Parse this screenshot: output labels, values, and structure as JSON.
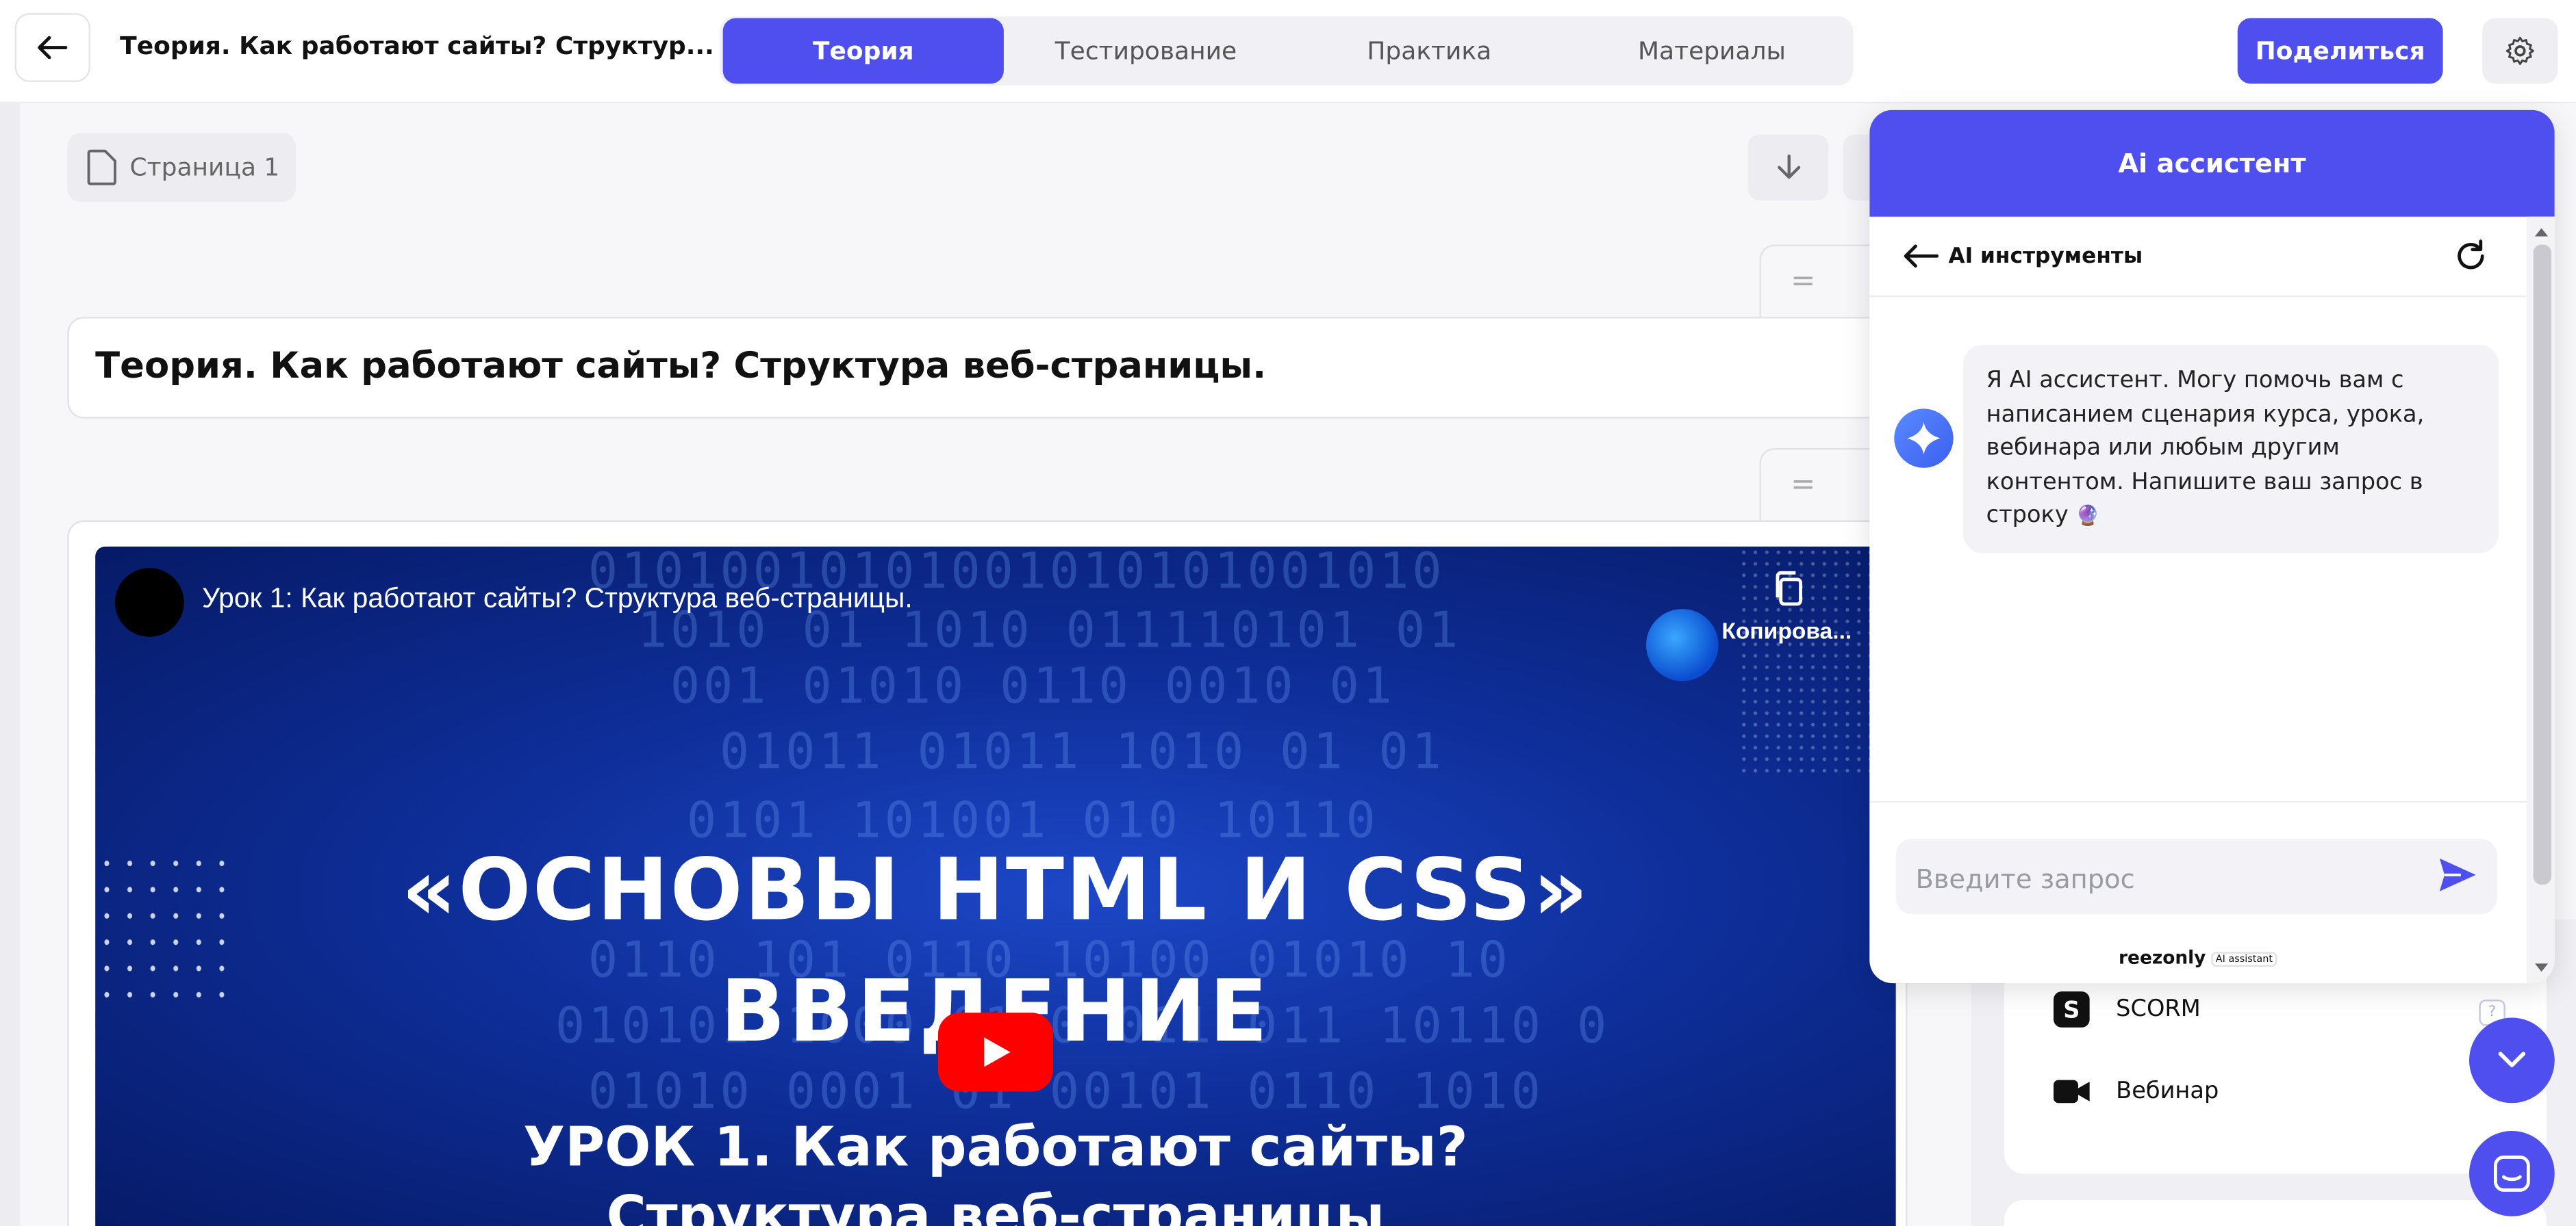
{
  "header": {
    "title": "Теория. Как работают сайты? Структур...",
    "tabs": [
      "Теория",
      "Тестирование",
      "Практика",
      "Материалы"
    ],
    "active_tab": "Теория",
    "share_label": "Поделиться"
  },
  "editor": {
    "page_label": "Страница 1",
    "block_title": "Теория. Как работают сайты? Структура веб-страницы.",
    "video": {
      "title": "Урок 1: Как работают сайты? Структура веб-страницы.",
      "copy_label": "Копирова...",
      "heading_1": "«ОСНОВЫ HTML И CSS»",
      "heading_2": "ВВЕДЕНИЕ",
      "heading_3": "УРОК 1. Как работают сайты?",
      "heading_4": "Структура веб-страницы"
    }
  },
  "side_panel": {
    "items": [
      {
        "label": "SCORM",
        "icon": "scorm-icon"
      },
      {
        "label": "Вебинар",
        "icon": "video-camera-icon"
      }
    ]
  },
  "chat": {
    "title": "Ai ассистент",
    "back_label": "AI инструменты",
    "message": "Я AI ассистент. Могу помочь вам с написанием сценария курса, урока, вебинара или любым другим контентом. Напишите ваш запрос в строку",
    "message_emoji": "🔮",
    "input_placeholder": "Введите запрос",
    "brand": "reezonly",
    "brand_badge": "AI assistant"
  },
  "colors": {
    "accent": "#4f4ff0",
    "youtube": "#ff0000"
  }
}
